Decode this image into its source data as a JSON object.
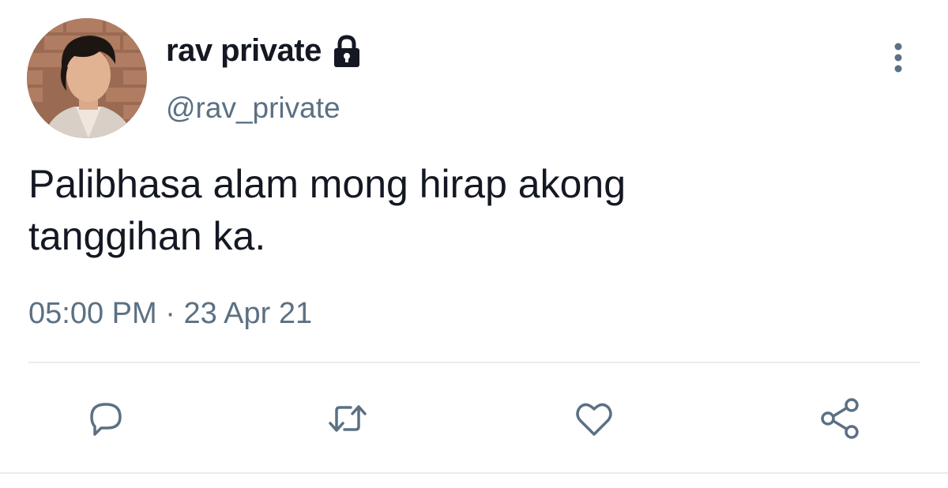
{
  "tweet": {
    "display_name": "rav private",
    "handle": "@rav_private",
    "text_line1": "Palibhasa alam mong hirap akong",
    "text_line2": "tanggihan ka.",
    "time": "05:00 PM",
    "separator": "·",
    "date": "23 Apr 21"
  },
  "icons": {
    "lock": "lock-icon",
    "more": "more-vertical-icon",
    "reply": "reply-icon",
    "retweet": "retweet-icon",
    "like": "heart-icon",
    "share": "share-icon"
  },
  "colors": {
    "text_primary": "#141823",
    "text_secondary": "#5b7083",
    "icon": "#5b7083",
    "divider": "#e6ecf0"
  }
}
